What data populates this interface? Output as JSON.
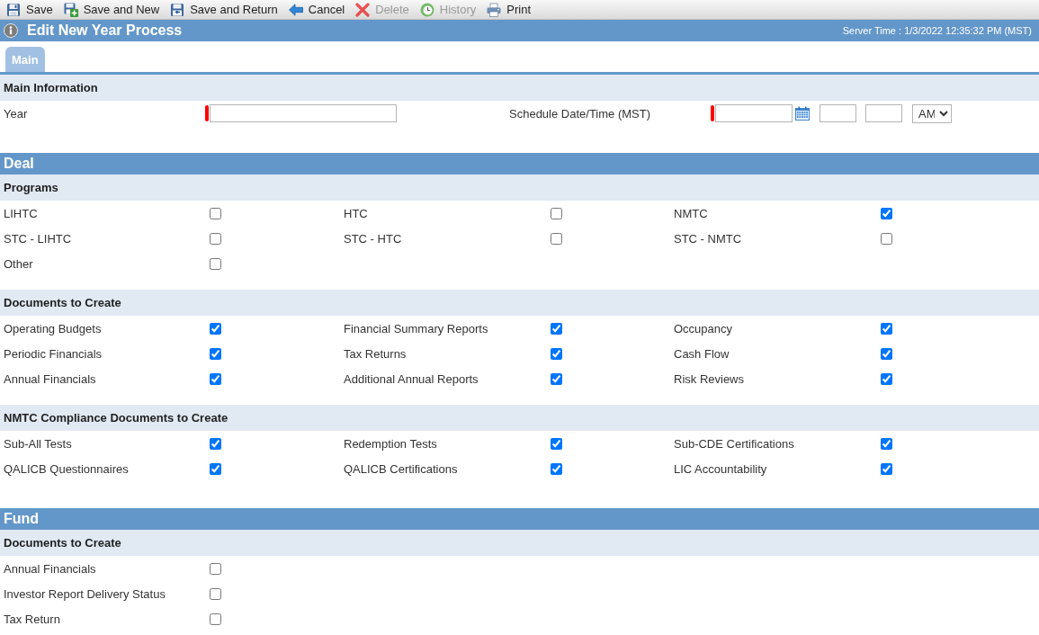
{
  "toolbar": [
    {
      "label": "Save",
      "disabled": false
    },
    {
      "label": "Save and New",
      "disabled": false
    },
    {
      "label": "Save and Return",
      "disabled": false
    },
    {
      "label": "Cancel",
      "disabled": false
    },
    {
      "label": "Delete",
      "disabled": true
    },
    {
      "label": "History",
      "disabled": true
    },
    {
      "label": "Print",
      "disabled": false
    }
  ],
  "header": {
    "title": "Edit New Year Process",
    "server_time": "Server Time : 1/3/2022 12:35:32 PM (MST)"
  },
  "tabs": [
    {
      "label": "Main",
      "selected": true
    }
  ],
  "main_information": {
    "title": "Main Information",
    "fields": [
      {
        "kind": "text",
        "label": "Year",
        "required": true
      },
      {
        "kind": "datetime",
        "label": "Schedule Date/Time (MST)",
        "required": true,
        "meridiem": "AM"
      }
    ]
  },
  "groups": [
    {
      "title": "Deal",
      "subsections": [
        {
          "title": "Programs",
          "rows": [
            [
              {
                "label": "LIHTC",
                "checked": false
              },
              {
                "label": "HTC",
                "checked": false
              },
              {
                "label": "NMTC",
                "checked": true
              }
            ],
            [
              {
                "label": "STC - LIHTC",
                "checked": false
              },
              {
                "label": "STC - HTC",
                "checked": false
              },
              {
                "label": "STC - NMTC",
                "checked": false
              }
            ],
            [
              {
                "label": "Other",
                "checked": false
              }
            ]
          ]
        },
        {
          "title": "Documents to Create",
          "rows": [
            [
              {
                "label": "Operating Budgets",
                "checked": true
              },
              {
                "label": "Financial Summary Reports",
                "checked": true
              },
              {
                "label": "Occupancy",
                "checked": true
              }
            ],
            [
              {
                "label": "Periodic Financials",
                "checked": true
              },
              {
                "label": "Tax Returns",
                "checked": true
              },
              {
                "label": "Cash Flow",
                "checked": true
              }
            ],
            [
              {
                "label": "Annual Financials",
                "checked": true
              },
              {
                "label": "Additional Annual Reports",
                "checked": true
              },
              {
                "label": "Risk Reviews",
                "checked": true
              }
            ]
          ]
        },
        {
          "title": "NMTC Compliance Documents to Create",
          "rows": [
            [
              {
                "label": "Sub-All Tests",
                "checked": true
              },
              {
                "label": "Redemption Tests",
                "checked": true
              },
              {
                "label": "Sub-CDE Certifications",
                "checked": true
              }
            ],
            [
              {
                "label": "QALICB Questionnaires",
                "checked": true
              },
              {
                "label": "QALICB Certifications",
                "checked": true
              },
              {
                "label": "LIC Accountability",
                "checked": true
              }
            ]
          ]
        }
      ]
    },
    {
      "title": "Fund",
      "subsections": [
        {
          "title": "Documents to Create",
          "rows": [
            [
              {
                "label": "Annual Financials",
                "checked": false
              }
            ],
            [
              {
                "label": "Investor Report Delivery Status",
                "checked": false
              }
            ],
            [
              {
                "label": "Tax Return",
                "checked": false
              }
            ]
          ]
        }
      ]
    }
  ]
}
